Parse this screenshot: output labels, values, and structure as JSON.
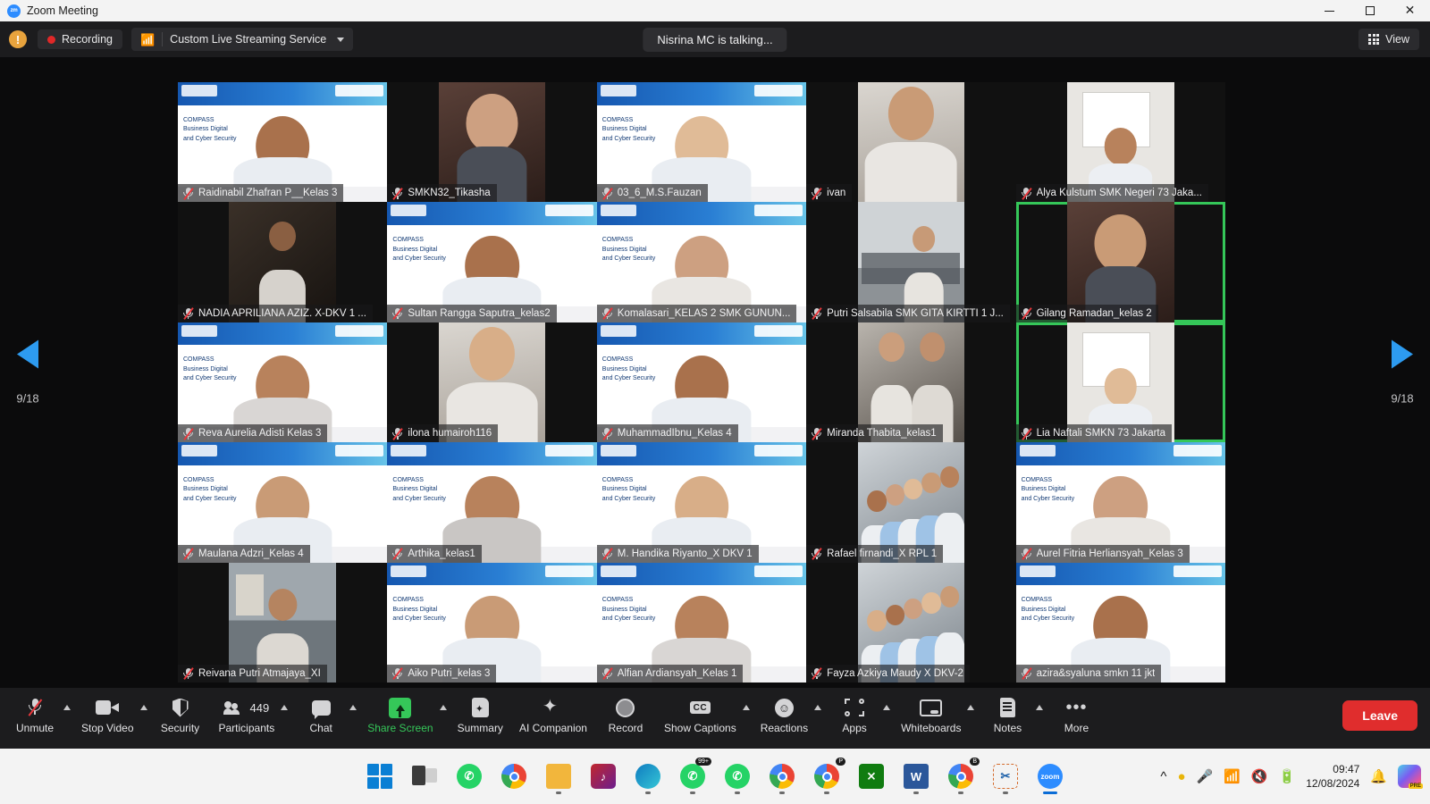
{
  "window": {
    "title": "Zoom Meeting",
    "logo_text": "zm",
    "controls": {
      "minimize": "minimize-button",
      "maximize": "maximize-button",
      "close": "✕"
    }
  },
  "topbar": {
    "security_icon": "shield-warning-icon",
    "recording_label": "Recording",
    "stream_icon": "rss-icon",
    "stream_label": "Custom Live Streaming Service",
    "talking_status": "Nisrina MC is talking...",
    "view_label": "View"
  },
  "gallery": {
    "page_left": "9/18",
    "page_right": "9/18",
    "participants": [
      {
        "name": "Raidinabil Zhafran P__Kelas 3",
        "muted": true,
        "kind": "slide-person",
        "speaking": false
      },
      {
        "name": "SMKN32_Tikasha",
        "muted": true,
        "kind": "narrow-closeup",
        "speaking": false
      },
      {
        "name": "03_6_M.S.Fauzan",
        "muted": true,
        "kind": "slide-person",
        "speaking": false
      },
      {
        "name": "ivan",
        "muted": true,
        "kind": "narrow-hijab",
        "speaking": false
      },
      {
        "name": "Alya Kulstum SMK Negeri 73 Jaka...",
        "muted": true,
        "kind": "narrow-room",
        "speaking": false
      },
      {
        "name": "NADIA APRILIANA AZIZ. X-DKV 1 ...",
        "muted": true,
        "kind": "dark-room",
        "speaking": false
      },
      {
        "name": "Sultan Rangga Saputra_kelas2",
        "muted": true,
        "kind": "slide-person",
        "speaking": false
      },
      {
        "name": "Komalasari_KELAS 2 SMK GUNUN...",
        "muted": true,
        "kind": "slide-person",
        "speaking": false
      },
      {
        "name": "Putri Salsabila SMK GITA KIRTTI 1 J...",
        "muted": true,
        "kind": "hall-room",
        "speaking": false
      },
      {
        "name": "Gilang Ramadan_kelas 2",
        "muted": true,
        "kind": "narrow-closeup",
        "speaking": true
      },
      {
        "name": "Reva Aurelia Adisti Kelas 3",
        "muted": true,
        "kind": "slide-person",
        "speaking": false
      },
      {
        "name": "ilona humairoh116",
        "muted": true,
        "kind": "narrow-hijab",
        "speaking": false
      },
      {
        "name": "MuhammadIbnu_Kelas 4",
        "muted": true,
        "kind": "slide-person",
        "speaking": false
      },
      {
        "name": "Miranda Thabita_kelas1",
        "muted": true,
        "kind": "two-girls",
        "speaking": false
      },
      {
        "name": "Lia Naftali SMKN 73 Jakarta",
        "muted": true,
        "kind": "narrow-room",
        "speaking": true
      },
      {
        "name": "Maulana Adzri_Kelas 4",
        "muted": true,
        "kind": "slide-person",
        "speaking": false
      },
      {
        "name": "Arthika_kelas1",
        "muted": true,
        "kind": "slide-person",
        "speaking": false
      },
      {
        "name": "M. Handika Riyanto_X DKV 1",
        "muted": true,
        "kind": "slide-person",
        "speaking": false
      },
      {
        "name": "Rafael firnandi_X RPL 1",
        "muted": true,
        "kind": "narrow-group",
        "speaking": false
      },
      {
        "name": "Aurel Fitria Herliansyah_Kelas 3",
        "muted": true,
        "kind": "slide-person",
        "speaking": true
      },
      {
        "name": "Reivana Putri Atmajaya_XI",
        "muted": true,
        "kind": "class-room",
        "speaking": false
      },
      {
        "name": "Aiko Putri_kelas 3",
        "muted": true,
        "kind": "slide-person",
        "speaking": false
      },
      {
        "name": "Alfian Ardiansyah_Kelas 1",
        "muted": true,
        "kind": "slide-person",
        "speaking": false
      },
      {
        "name": "Fayza Azkiya Maudy X DKV-2",
        "muted": true,
        "kind": "narrow-group",
        "speaking": false
      },
      {
        "name": "azira&syaluna smkn 11 jkt",
        "muted": true,
        "kind": "slide-person",
        "speaking": false
      }
    ]
  },
  "toolbar": {
    "items": [
      {
        "label": "Unmute",
        "icon": "microphone-muted-icon",
        "caret": true
      },
      {
        "label": "Stop Video",
        "icon": "camera-icon",
        "caret": true
      },
      {
        "label": "Security",
        "icon": "shield-icon",
        "caret": false
      },
      {
        "label": "Participants",
        "icon": "people-icon",
        "caret": true,
        "badge": "449"
      },
      {
        "label": "Chat",
        "icon": "chat-bubble-icon",
        "caret": true
      },
      {
        "label": "Share Screen",
        "icon": "share-screen-icon",
        "caret": true,
        "green": true
      },
      {
        "label": "Summary",
        "icon": "summary-icon",
        "caret": false
      },
      {
        "label": "AI Companion",
        "icon": "ai-sparkle-icon",
        "caret": false
      },
      {
        "label": "Record",
        "icon": "record-icon",
        "caret": false
      },
      {
        "label": "Show Captions",
        "icon": "closed-captions-icon",
        "caret": true
      },
      {
        "label": "Reactions",
        "icon": "reactions-icon",
        "caret": true
      },
      {
        "label": "Apps",
        "icon": "apps-icon",
        "caret": true
      },
      {
        "label": "Whiteboards",
        "icon": "whiteboard-icon",
        "caret": true
      },
      {
        "label": "Notes",
        "icon": "notes-icon",
        "caret": true
      },
      {
        "label": "More",
        "icon": "more-dots-icon",
        "caret": false
      }
    ],
    "leave_label": "Leave"
  },
  "taskbar": {
    "apps": [
      {
        "name": "start-button",
        "icon": "windows-logo-icon",
        "running": false
      },
      {
        "name": "task-view-button",
        "icon": "task-view-icon",
        "running": false
      },
      {
        "name": "whatsapp-pinned",
        "icon": "whatsapp-icon",
        "running": false
      },
      {
        "name": "chrome-1",
        "icon": "chrome-icon",
        "running": false
      },
      {
        "name": "file-explorer",
        "icon": "folder-icon",
        "running": true
      },
      {
        "name": "app-pink",
        "icon": "media-app-icon",
        "running": false
      },
      {
        "name": "edge",
        "icon": "edge-icon",
        "running": true
      },
      {
        "name": "whatsapp-badge",
        "icon": "whatsapp-icon",
        "running": true,
        "badge": "99+"
      },
      {
        "name": "whatsapp-2",
        "icon": "whatsapp-icon",
        "running": true
      },
      {
        "name": "chrome-profile",
        "icon": "chrome-icon",
        "running": true
      },
      {
        "name": "chrome-profile-p",
        "icon": "chrome-icon",
        "running": true,
        "badge": "P"
      },
      {
        "name": "xbox",
        "icon": "xbox-icon",
        "running": false
      },
      {
        "name": "word",
        "icon": "word-icon",
        "running": true
      },
      {
        "name": "chrome-profile-b",
        "icon": "chrome-icon",
        "running": true,
        "badge": "B"
      },
      {
        "name": "snipping-tool",
        "icon": "scissors-icon",
        "running": true
      },
      {
        "name": "zoom-app",
        "icon": "zoom-icon",
        "running": true,
        "active": true
      }
    ],
    "tray": {
      "overflow": "show-hidden-icons",
      "onedrive": "onedrive-sync-icon",
      "mic": "microphone-icon",
      "wifi": "wifi-icon",
      "volume": "volume-muted-icon",
      "battery": "battery-charging-icon",
      "time": "09:47",
      "date": "12/08/2024",
      "notifications": "bell-icon",
      "copilot": "copilot-icon",
      "copilot_badge": "PRE"
    }
  }
}
